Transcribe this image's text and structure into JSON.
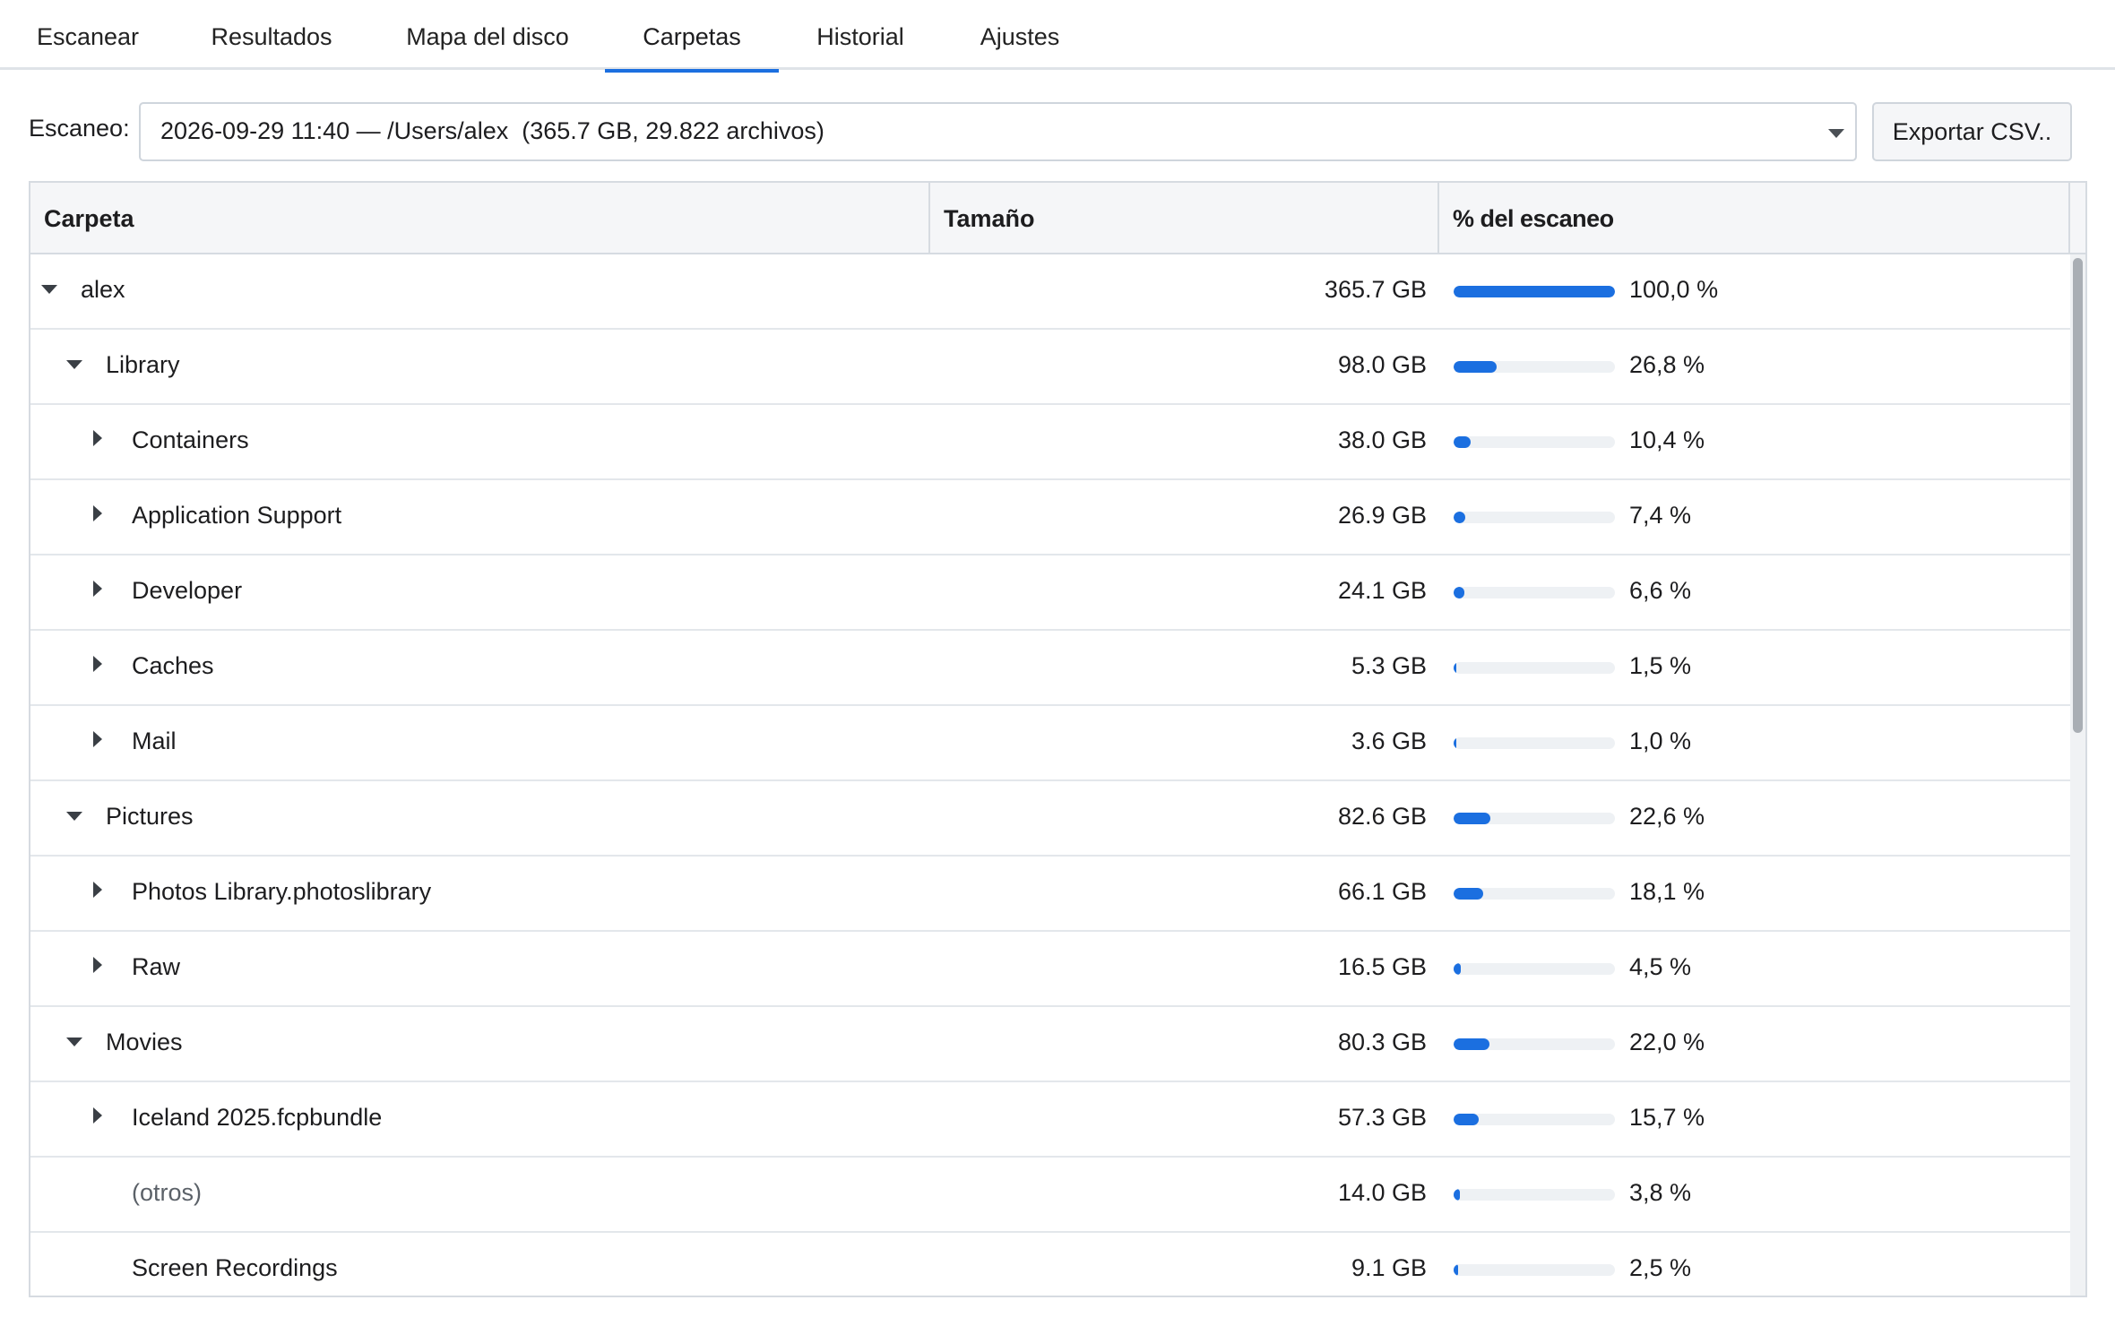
{
  "tabs": [
    {
      "label": "Escanear",
      "active": false
    },
    {
      "label": "Resultados",
      "active": false
    },
    {
      "label": "Mapa del disco",
      "active": false
    },
    {
      "label": "Carpetas",
      "active": true
    },
    {
      "label": "Historial",
      "active": false
    },
    {
      "label": "Ajustes",
      "active": false
    }
  ],
  "scan": {
    "label": "Escaneo:",
    "selected": "2026-09-29 11:40 — /Users/alex  (365.7 GB, 29.822 archivos)",
    "export_label": "Exportar CSV.."
  },
  "table": {
    "columns": [
      "Carpeta",
      "Tamaño",
      "% del escaneo"
    ],
    "rows": [
      {
        "name": "alex",
        "level": 0,
        "toggle": "open",
        "size": "365.7 GB",
        "percent": "100,0 %",
        "fraction": 1.0
      },
      {
        "name": "Library",
        "level": 1,
        "toggle": "open",
        "size": "98.0 GB",
        "percent": "26,8 %",
        "fraction": 0.268
      },
      {
        "name": "Containers",
        "level": 2,
        "toggle": "closed",
        "size": "38.0 GB",
        "percent": "10,4 %",
        "fraction": 0.104
      },
      {
        "name": "Application Support",
        "level": 2,
        "toggle": "closed",
        "size": "26.9 GB",
        "percent": "7,4 %",
        "fraction": 0.074
      },
      {
        "name": "Developer",
        "level": 2,
        "toggle": "closed",
        "size": "24.1 GB",
        "percent": "6,6 %",
        "fraction": 0.066
      },
      {
        "name": "Caches",
        "level": 2,
        "toggle": "closed",
        "size": "5.3 GB",
        "percent": "1,5 %",
        "fraction": 0.015
      },
      {
        "name": "Mail",
        "level": 2,
        "toggle": "closed",
        "size": "3.6 GB",
        "percent": "1,0 %",
        "fraction": 0.01
      },
      {
        "name": "Pictures",
        "level": 1,
        "toggle": "open",
        "size": "82.6 GB",
        "percent": "22,6 %",
        "fraction": 0.226
      },
      {
        "name": "Photos Library.photoslibrary",
        "level": 2,
        "toggle": "closed",
        "size": "66.1 GB",
        "percent": "18,1 %",
        "fraction": 0.181
      },
      {
        "name": "Raw",
        "level": 2,
        "toggle": "closed",
        "size": "16.5 GB",
        "percent": "4,5 %",
        "fraction": 0.045
      },
      {
        "name": "Movies",
        "level": 1,
        "toggle": "open",
        "size": "80.3 GB",
        "percent": "22,0 %",
        "fraction": 0.22
      },
      {
        "name": "Iceland 2025.fcpbundle",
        "level": 2,
        "toggle": "closed",
        "size": "57.3 GB",
        "percent": "15,7 %",
        "fraction": 0.157
      },
      {
        "name": "(otros)",
        "level": 2,
        "toggle": "none",
        "muted": true,
        "size": "14.0 GB",
        "percent": "3,8 %",
        "fraction": 0.038
      },
      {
        "name": "Screen Recordings",
        "level": 2,
        "toggle": "none",
        "size": "9.1 GB",
        "percent": "2,5 %",
        "fraction": 0.025
      }
    ]
  },
  "colors": {
    "accent": "#1b6fe0",
    "track": "#eef1f4"
  }
}
